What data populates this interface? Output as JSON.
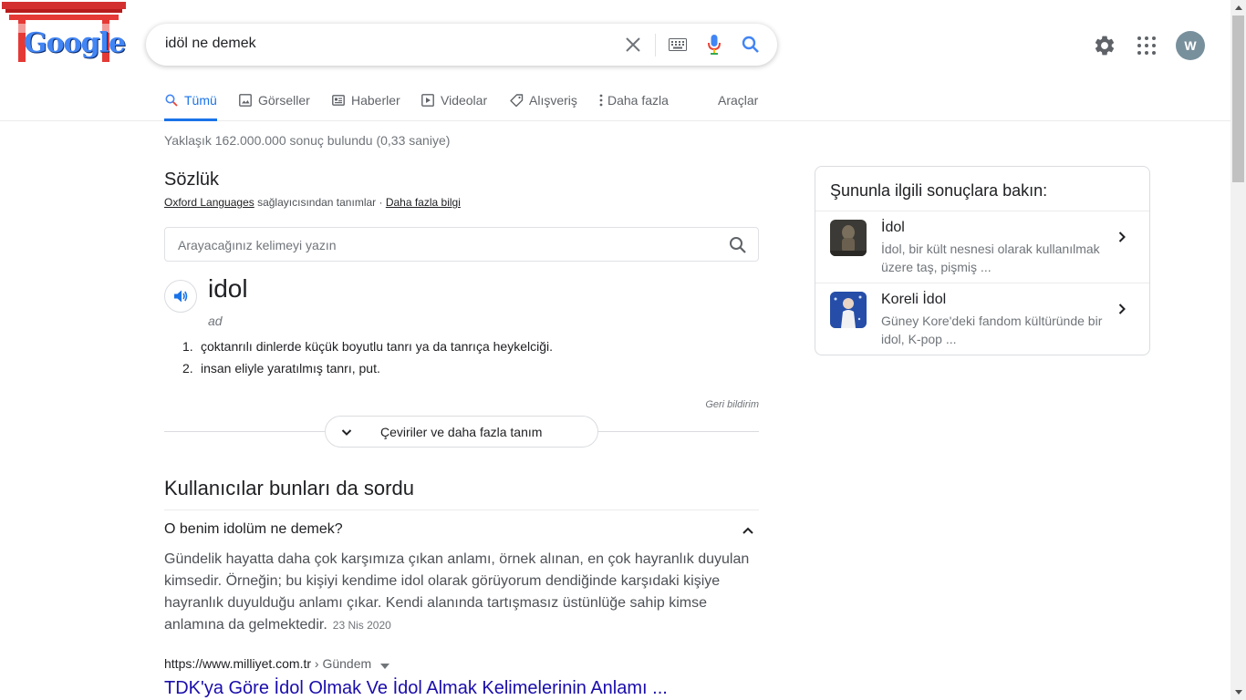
{
  "header": {
    "logo_text": "Google",
    "search_query": "idöl ne demek",
    "avatar_letter": "W"
  },
  "tabs": [
    {
      "label": "Tümü",
      "icon": "search-icon",
      "active": true
    },
    {
      "label": "Görseller",
      "icon": "image-icon"
    },
    {
      "label": "Haberler",
      "icon": "news-icon"
    },
    {
      "label": "Videolar",
      "icon": "play-icon"
    },
    {
      "label": "Alışveriş",
      "icon": "tag-icon"
    },
    {
      "label": "Daha fazla",
      "icon": "more-vert-icon"
    },
    {
      "label": "Araçlar"
    }
  ],
  "stats": "Yaklaşık 162.000.000 sonuç bulundu (0,33 saniye)",
  "dictionary": {
    "title": "Sözlük",
    "source_link": "Oxford Languages",
    "source_text": " sağlayıcısından tanımlar · ",
    "more_info_link": "Daha fazla bilgi",
    "input_placeholder": "Arayacağınız kelimeyi yazın",
    "word": "idol",
    "part_of_speech": "ad",
    "definitions": [
      {
        "num": "1.",
        "text": "çoktanrılı dinlerde küçük boyutlu tanrı ya da tanrıça heykelciği."
      },
      {
        "num": "2.",
        "text": "insan eliyle yaratılmış tanrı, put."
      }
    ],
    "feedback": "Geri bildirim",
    "more_button": "Çeviriler ve daha fazla tanım"
  },
  "paa": {
    "title": "Kullanıcılar bunları da sordu",
    "question": "O benim idolüm ne demek?",
    "answer": "Gündelik hayatta daha çok karşımıza çıkan anlamı, örnek alınan, en çok hayranlık duyulan kimsedir. Örneğin; bu kişiyi kendime idol olarak görüyorum dendiğinde karşıdaki kişiye hayranlık duyulduğu anlamı çıkar. Kendi alanında tartışmasız üstünlüğe sahip kimse anlamına da gelmektedir.",
    "date": "23 Nis 2020",
    "result_url": "https://www.milliyet.com.tr",
    "result_crumb": " › Gündem",
    "result_title": "TDK'ya Göre İdol Olmak Ve İdol Almak Kelimelerinin Anlamı ..."
  },
  "side_panel": {
    "title": "Şununla ilgili sonuçlara bakın:",
    "items": [
      {
        "name": "İdol",
        "desc": "İdol, bir kült nesnesi olarak kullanılmak üzere taş, pişmiş ..."
      },
      {
        "name": "Koreli İdol",
        "desc": "Güney Kore'deki fandom kültüründe bir idol, K-pop ..."
      }
    ]
  },
  "colors": {
    "link": "#1a0dab",
    "accent": "#1a73e8",
    "avatar_bg": "#78909c"
  }
}
